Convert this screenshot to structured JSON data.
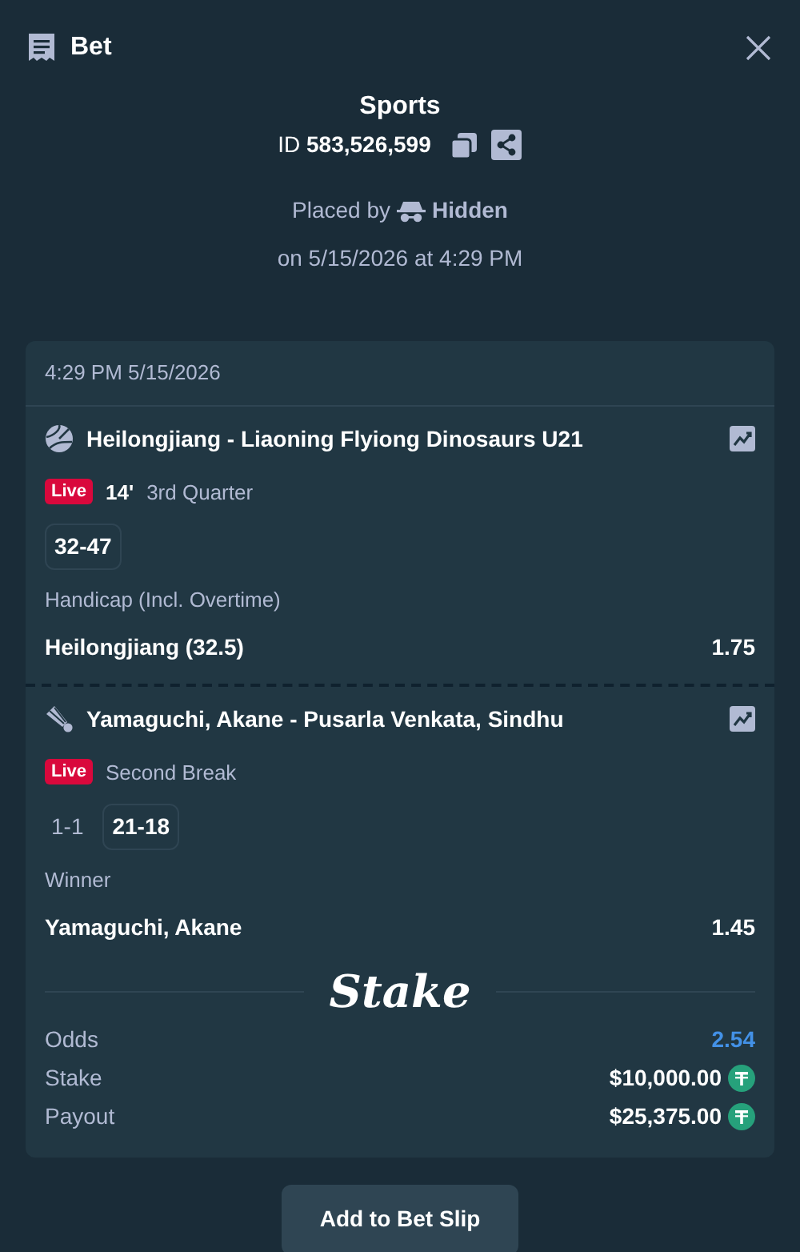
{
  "header": {
    "title": "Bet"
  },
  "summary": {
    "category": "Sports",
    "id_label": "ID",
    "id": "583,526,599",
    "placed_by_label": "Placed by",
    "placed_by": "Hidden",
    "placed_on": "on 5/15/2026 at 4:29 PM"
  },
  "card": {
    "timestamp": "4:29 PM 5/15/2026",
    "legs": [
      {
        "kind": "basketball",
        "event": "Heilongjiang - Liaoning Flyiong Dinosaurs U21",
        "live": "Live",
        "minute": "14'",
        "period": "3rd Quarter",
        "score": "32-47",
        "market": "Handicap (Incl. Overtime)",
        "selection": "Heilongjiang (32.5)",
        "odds": "1.75"
      },
      {
        "kind": "badminton",
        "event": "Yamaguchi, Akane - Pusarla Venkata, Sindhu",
        "live": "Live",
        "period": "Second Break",
        "sets": "1-1",
        "score": "21-18",
        "market": "Winner",
        "selection": "Yamaguchi, Akane",
        "odds": "1.45"
      }
    ],
    "logo": "Stake",
    "totals": [
      {
        "kind": "odds",
        "label": "Odds",
        "value": "2.54"
      },
      {
        "kind": "money",
        "label": "Stake",
        "value": "$10,000.00"
      },
      {
        "kind": "money",
        "label": "Payout",
        "value": "$25,375.00"
      }
    ]
  },
  "button": "Add to Bet Slip"
}
